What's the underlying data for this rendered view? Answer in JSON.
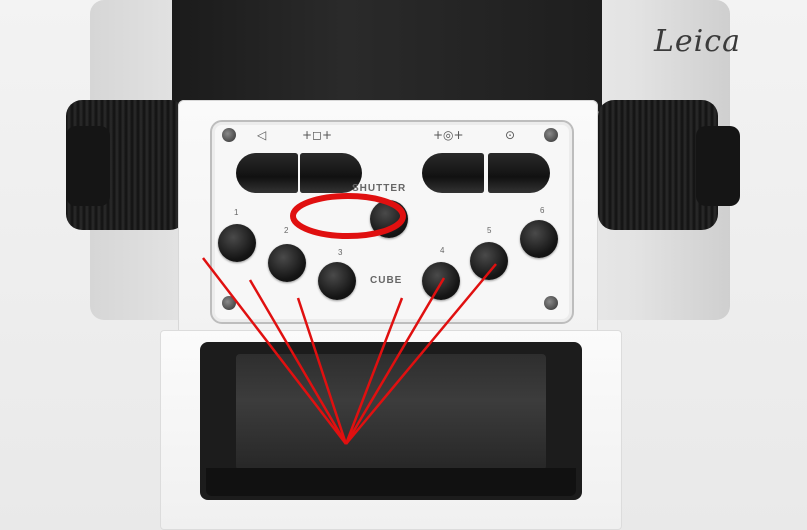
{
  "brand_text": "Leica",
  "panel": {
    "shutter_label": "SHUTTER",
    "cube_label": "CUBE",
    "symbols": {
      "left_1": "◁",
      "left_2": "+◻+",
      "right_1": "+◎+",
      "right_2": "⊙"
    },
    "button_numbers": [
      "1",
      "2",
      "3",
      "4",
      "5",
      "6"
    ]
  },
  "annotation": {
    "color": "#e01010"
  }
}
